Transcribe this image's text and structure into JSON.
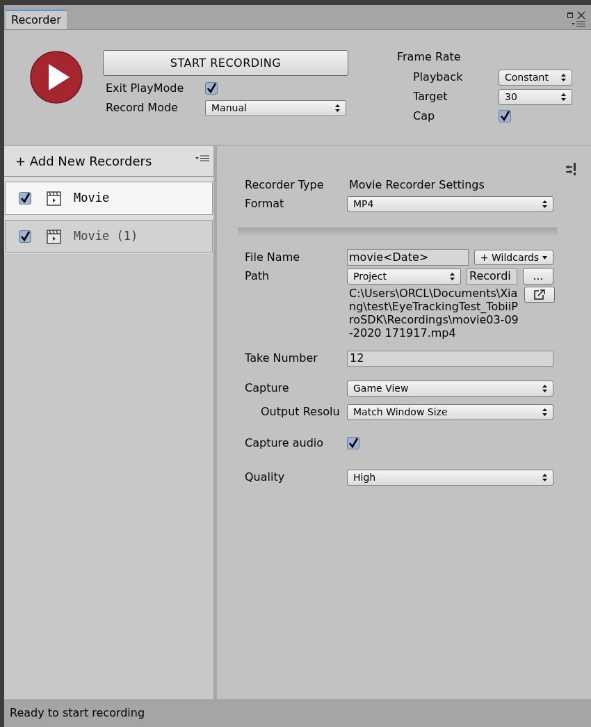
{
  "tab": {
    "title": "Recorder"
  },
  "top": {
    "start_button": "START RECORDING",
    "exit_playmode": {
      "label": "Exit PlayMode",
      "checked": true
    },
    "record_mode": {
      "label": "Record Mode",
      "value": "Manual"
    },
    "frame_rate": {
      "title": "Frame Rate",
      "playback": {
        "label": "Playback",
        "value": "Constant"
      },
      "target": {
        "label": "Target",
        "value": "30"
      },
      "cap": {
        "label": "Cap",
        "checked": true
      }
    }
  },
  "recorders": {
    "add_label": "+ Add New Recorders",
    "items": [
      {
        "name": "Movie",
        "checked": true,
        "selected": true
      },
      {
        "name": "Movie (1)",
        "checked": true,
        "selected": false
      }
    ]
  },
  "settings": {
    "recorder_type": {
      "label": "Recorder Type",
      "value": "Movie Recorder Settings"
    },
    "format": {
      "label": "Format",
      "value": "MP4"
    },
    "file_name": {
      "label": "File Name",
      "value": "movie<Date>",
      "wildcards": "+ Wildcards"
    },
    "path": {
      "label": "Path",
      "root": "Project",
      "folder": "Recordi",
      "browse": "...",
      "full_path": "C:\\Users\\ORCL\\Documents\\Xiang\\test\\EyeTrackingTest_TobiiProSDK\\Recordings\\movie03-09-2020 171917.mp4"
    },
    "take_number": {
      "label": "Take Number",
      "value": "12"
    },
    "capture": {
      "label": "Capture",
      "value": "Game View"
    },
    "output_resolution": {
      "label": "Output Resolu",
      "value": "Match Window Size"
    },
    "capture_audio": {
      "label": "Capture audio",
      "checked": true
    },
    "quality": {
      "label": "Quality",
      "value": "High"
    }
  },
  "status_bar": "Ready to start recording"
}
